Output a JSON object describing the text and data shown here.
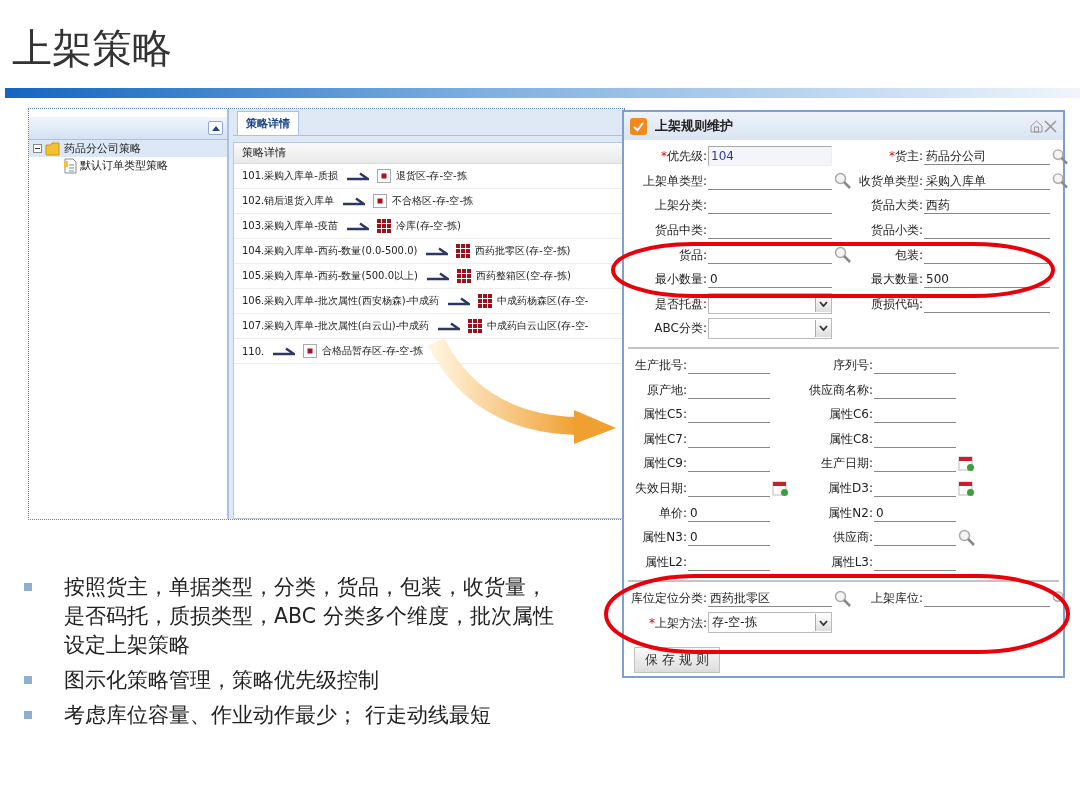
{
  "slide": {
    "title": "上架策略"
  },
  "tree": [
    {
      "label": "药品分公司策略",
      "expanded": true,
      "selected": true,
      "children": [
        {
          "label": "默认订单类型策略",
          "selected": false
        }
      ]
    }
  ],
  "tabs": [
    {
      "label": "策略详情",
      "selected": true
    }
  ],
  "strategy": {
    "header": "策略详情",
    "rows": [
      {
        "rule": "101.采购入库单-质损",
        "kind": "single",
        "target": "退货区-存-空-拣"
      },
      {
        "rule": "102.销后退货入库单",
        "kind": "single",
        "target": "不合格区-存-空-拣"
      },
      {
        "rule": "103.采购入库单-疫苗",
        "kind": "grid",
        "target": "冷库(存-空-拣)"
      },
      {
        "rule": "104.采购入库单-西药-数量(0.0-500.0)",
        "kind": "grid",
        "target": "西药批零区(存-空-拣)"
      },
      {
        "rule": "105.采购入库单-西药-数量(500.0以上)",
        "kind": "grid",
        "target": "西药整箱区(空-存-拣)"
      },
      {
        "rule": "106.采购入库单-批次属性(西安杨森)-中成药",
        "kind": "grid",
        "target": "中成药杨森区(存-空-"
      },
      {
        "rule": "107.采购入库单-批次属性(白云山)-中成药",
        "kind": "grid",
        "target": "中成药白云山区(存-空-"
      },
      {
        "rule": "110.",
        "kind": "single",
        "target": "合格品暂存区-存-空-拣"
      }
    ]
  },
  "dialog": {
    "title": "上架规则维护",
    "sections": [
      {
        "kind": "wide",
        "fields": [
          {
            "label": "优先级:",
            "mark": "*",
            "kind": "input",
            "value": "104"
          },
          {
            "label": "货主:",
            "mark": "*",
            "kind": "lookup",
            "value": "药品分公司"
          },
          {
            "label": "上架单类型:",
            "kind": "lookup"
          },
          {
            "label": "收货单类型:",
            "kind": "lookup",
            "value": "采购入库单"
          },
          {
            "label": "上架分类:",
            "kind": "line"
          },
          {
            "label": "货品大类:",
            "kind": "line",
            "value": "西药"
          },
          {
            "label": "货品中类:",
            "kind": "line"
          },
          {
            "label": "货品小类:",
            "kind": "line"
          },
          {
            "label": "货品:",
            "kind": "lookup"
          },
          {
            "label": "包装:",
            "kind": "line"
          },
          {
            "label": "最小数量:",
            "kind": "line",
            "value": "0"
          },
          {
            "label": "最大数量:",
            "kind": "line",
            "value": "500"
          },
          {
            "label": "是否托盘:",
            "kind": "select"
          },
          {
            "label": "质损代码:",
            "kind": "line"
          },
          {
            "label": "ABC分类:",
            "kind": "select"
          }
        ]
      },
      {
        "kind": "narrow",
        "fields": [
          {
            "label": "生产批号:",
            "kind": "line"
          },
          {
            "label": "序列号:",
            "kind": "line"
          },
          {
            "label": "原产地:",
            "kind": "line"
          },
          {
            "label": "供应商名称:",
            "kind": "line"
          },
          {
            "label": "属性C5:",
            "kind": "line"
          },
          {
            "label": "属性C6:",
            "kind": "line"
          },
          {
            "label": "属性C7:",
            "kind": "line"
          },
          {
            "label": "属性C8:",
            "kind": "line"
          },
          {
            "label": "属性C9:",
            "kind": "line"
          },
          {
            "label": "生产日期:",
            "kind": "date"
          },
          {
            "label": "失效日期:",
            "kind": "date"
          },
          {
            "label": "属性D3:",
            "kind": "date"
          },
          {
            "label": "单价:",
            "kind": "line",
            "value": "0"
          },
          {
            "label": "属性N2:",
            "kind": "line",
            "value": "0"
          },
          {
            "label": "属性N3:",
            "kind": "line",
            "value": "0"
          },
          {
            "label": "供应商:",
            "kind": "lookup"
          },
          {
            "label": "属性L2:",
            "kind": "line"
          },
          {
            "label": "属性L3:",
            "kind": "line"
          }
        ]
      },
      {
        "kind": "wide",
        "fields": [
          {
            "label": "库位定位分类:",
            "kind": "lookup",
            "value": "西药批零区"
          },
          {
            "label": "上架库位:",
            "kind": "lookup"
          },
          {
            "label": "上架方法:",
            "mark": "*",
            "kind": "select",
            "value": "存-空-拣"
          }
        ]
      }
    ],
    "button": "保 存 规 则"
  },
  "bullets": [
    {
      "lines": [
        "按照货主，单据类型，分类，货品，包装，收货量，",
        "是否码托，质损类型，ABC 分类多个维度，批次属性",
        "设定上架策略"
      ]
    },
    {
      "lines": [
        "图示化策略管理，策略优先级控制"
      ]
    },
    {
      "lines": [
        "考虑库位容量、作业动作最少； 行走动线最短"
      ]
    }
  ]
}
